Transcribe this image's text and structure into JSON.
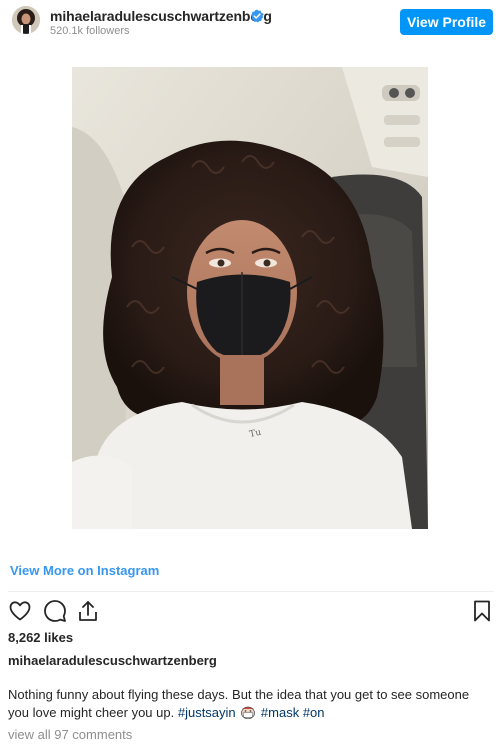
{
  "header": {
    "username": "mihaelaradulescuschwartzenberg",
    "followers": "520.1k followers",
    "view_profile_label": "View Profile"
  },
  "post": {
    "view_more_label": "View More on Instagram",
    "likes": "8,262 likes",
    "username": "mihaelaradulescuschwartzenberg",
    "caption_text": "Nothing funny about flying these days. But the idea that you get to see someone you love might cheer you up.",
    "hashtags": [
      "#justsayin",
      "#mask",
      "#on"
    ],
    "comments_link": "view all 97 comments"
  },
  "icons": {
    "verified": "verified-badge-icon",
    "like": "heart-icon",
    "comment": "comment-icon",
    "share": "share-icon",
    "save": "bookmark-icon",
    "emoji": "face-with-medical-mask-icon"
  },
  "colors": {
    "accent": "#0095f6",
    "link": "#3897f0",
    "hashtag": "#00376b",
    "muted": "#8e8e8e"
  }
}
